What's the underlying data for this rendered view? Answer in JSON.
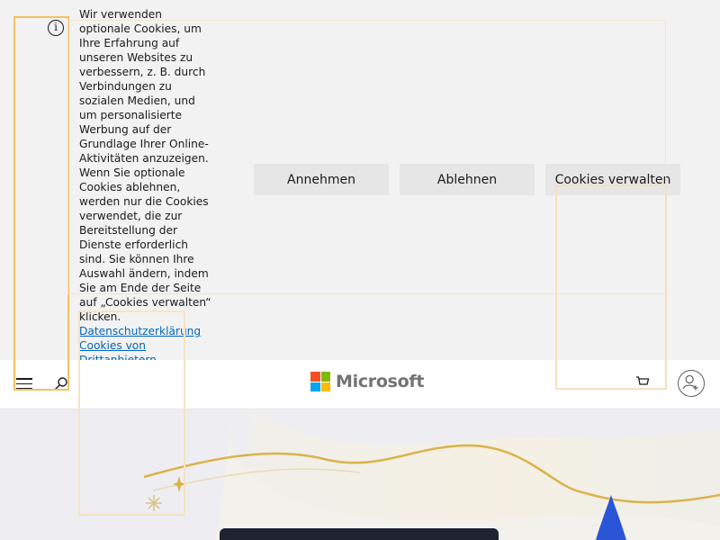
{
  "cookie_banner": {
    "info_icon": "info-icon",
    "text": "Wir verwenden optionale Cookies, um Ihre Erfahrung auf unseren Websites zu verbessern, z. B. durch Verbindungen zu sozialen Medien, und um personalisierte Werbung auf der Grundlage Ihrer Online-Aktivitäten anzuzeigen. Wenn Sie optionale Cookies ablehnen, werden nur die Cookies verwendet, die zur Bereitstellung der Dienste erforderlich sind. Sie können Ihre Auswahl ändern, indem Sie am Ende der Seite auf „Cookies verwalten“ klicken.",
    "links": {
      "privacy": "Datenschutzerklärung",
      "third_party": "Cookies von Drittanbietern"
    },
    "buttons": {
      "accept": "Annehmen",
      "reject": "Ablehnen",
      "manage": "Cookies verwalten"
    }
  },
  "header": {
    "menu_icon": "hamburger-menu-icon",
    "search_icon": "search-icon",
    "logo_text": "Microsoft",
    "cart_icon": "cart-icon",
    "account_icon": "account-icon"
  },
  "colors": {
    "link": "#0067b8",
    "button_bg": "#e6e6e6",
    "banner_bg": "#f2f2f2",
    "logo_red": "#f25022",
    "logo_green": "#7fba00",
    "logo_blue": "#00a4ef",
    "logo_yellow": "#ffb900",
    "frame_accent": "#f3c160"
  }
}
